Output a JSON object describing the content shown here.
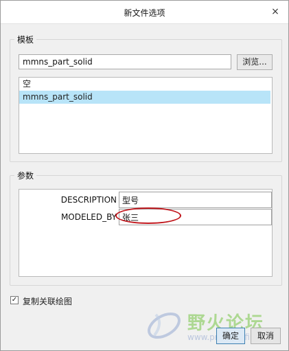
{
  "dialog": {
    "title": "新文件选项",
    "close_glyph": "×"
  },
  "template_group": {
    "legend": "模板",
    "input_value": "mmns_part_solid",
    "browse_label": "浏览...",
    "list": [
      {
        "label": "空",
        "selected": false
      },
      {
        "label": "mmns_part_solid",
        "selected": true
      }
    ]
  },
  "params_group": {
    "legend": "参数",
    "rows": [
      {
        "name": "DESCRIPTION",
        "value": "型号"
      },
      {
        "name": "MODELED_BY",
        "value": "张三"
      }
    ]
  },
  "copy_drawing": {
    "label": "复制关联绘图",
    "checked": true,
    "check_glyph": "✓"
  },
  "buttons": {
    "ok": "确定",
    "cancel": "取消"
  },
  "watermark": {
    "text": "野火论坛",
    "url": "www.proewildfire.cn"
  },
  "colors": {
    "selection": "#b8e4f8",
    "annotation": "#c0161c",
    "watermark_green": "#76c446"
  },
  "icons": [
    "close-icon",
    "checkbox-checked-icon",
    "watermark-logo-icon"
  ]
}
